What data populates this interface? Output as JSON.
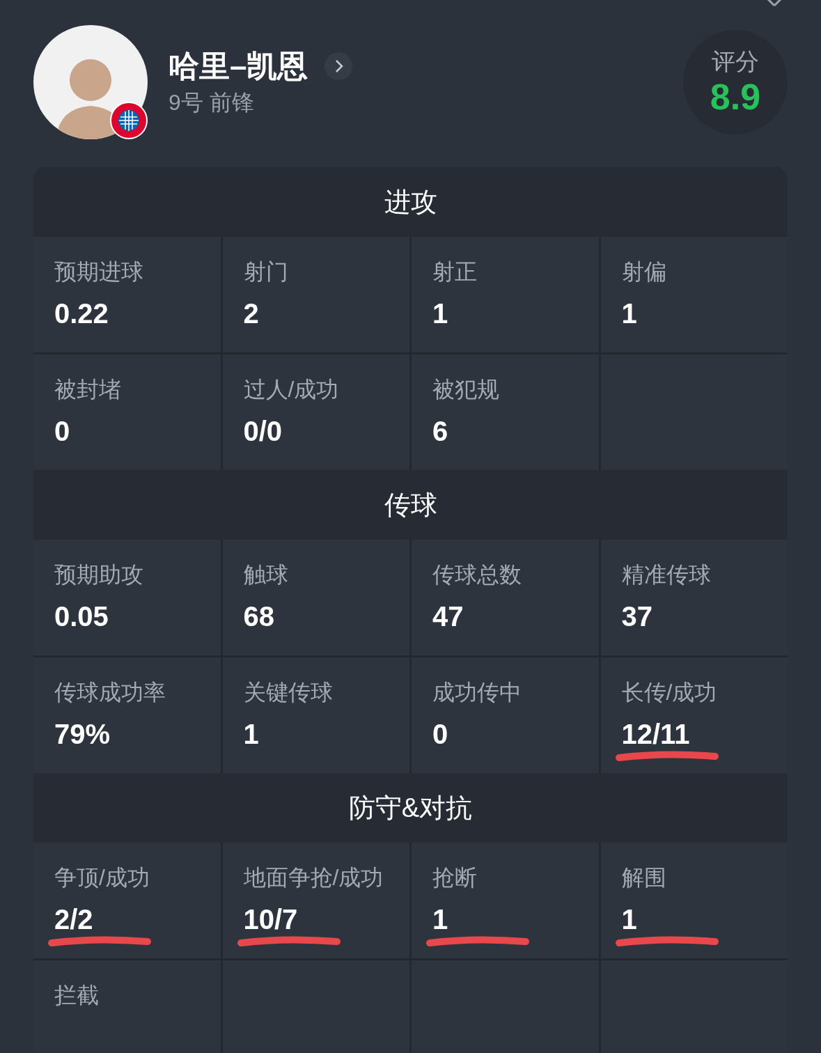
{
  "header": {
    "name": "哈里–凯恩",
    "subtitle": "9号 前锋",
    "rating_label": "评分",
    "rating": "8.9"
  },
  "sections": [
    {
      "title": "进攻",
      "cells": [
        {
          "label": "预期进球",
          "value": "0.22",
          "underlined": false
        },
        {
          "label": "射门",
          "value": "2",
          "underlined": false
        },
        {
          "label": "射正",
          "value": "1",
          "underlined": false
        },
        {
          "label": "射偏",
          "value": "1",
          "underlined": false
        },
        {
          "label": "被封堵",
          "value": "0",
          "underlined": false
        },
        {
          "label": "过人/成功",
          "value": "0/0",
          "underlined": false
        },
        {
          "label": "被犯规",
          "value": "6",
          "underlined": false
        }
      ]
    },
    {
      "title": "传球",
      "cells": [
        {
          "label": "预期助攻",
          "value": "0.05",
          "underlined": false
        },
        {
          "label": "触球",
          "value": "68",
          "underlined": false
        },
        {
          "label": "传球总数",
          "value": "47",
          "underlined": false
        },
        {
          "label": "精准传球",
          "value": "37",
          "underlined": false
        },
        {
          "label": "传球成功率",
          "value": "79%",
          "underlined": false
        },
        {
          "label": "关键传球",
          "value": "1",
          "underlined": false
        },
        {
          "label": "成功传中",
          "value": "0",
          "underlined": false
        },
        {
          "label": "长传/成功",
          "value": "12/11",
          "underlined": true
        }
      ]
    },
    {
      "title": "防守&对抗",
      "cells": [
        {
          "label": "争顶/成功",
          "value": "2/2",
          "underlined": true
        },
        {
          "label": "地面争抢/成功",
          "value": "10/7",
          "underlined": true
        },
        {
          "label": "抢断",
          "value": "1",
          "underlined": true
        },
        {
          "label": "解围",
          "value": "1",
          "underlined": true
        },
        {
          "label": "拦截"
        }
      ]
    }
  ]
}
